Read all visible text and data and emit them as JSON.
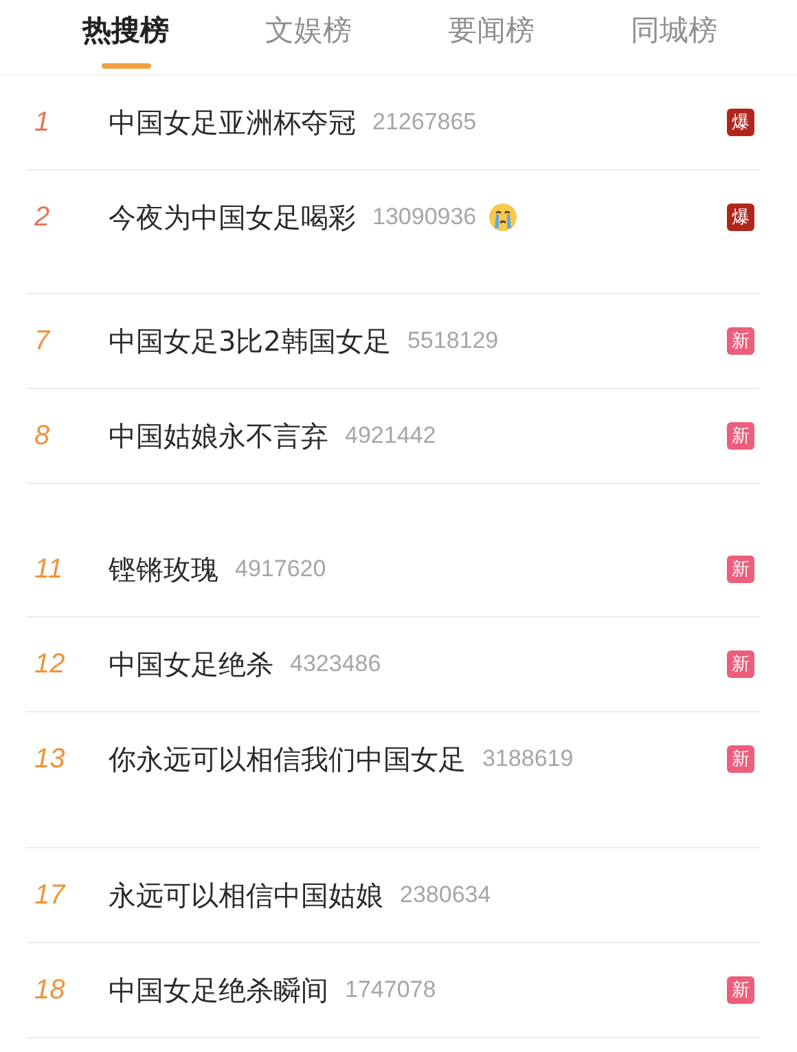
{
  "tabs": [
    {
      "label": "热搜榜",
      "selected": true
    },
    {
      "label": "文娱榜",
      "selected": false
    },
    {
      "label": "要闻榜",
      "selected": false
    },
    {
      "label": "同城榜",
      "selected": false
    }
  ],
  "groups": [
    {
      "rows": [
        {
          "rank": "1",
          "color": "#e5735d",
          "title": "中国女足亚洲杯夺冠",
          "count": "21267865",
          "emoji": false,
          "badge": {
            "kind": "hot",
            "text": "爆"
          }
        },
        {
          "rank": "2",
          "color": "#e5735d",
          "title": "今夜为中国女足喝彩",
          "count": "13090936",
          "emoji": true,
          "badge": {
            "kind": "hot",
            "text": "爆"
          }
        }
      ]
    },
    {
      "rows": [
        {
          "rank": "7",
          "color": "#ef9337",
          "title": "中国女足3比2韩国女足",
          "count": "5518129",
          "emoji": false,
          "badge": {
            "kind": "new",
            "text": "新"
          }
        },
        {
          "rank": "8",
          "color": "#ef9337",
          "title": "中国姑娘永不言弃",
          "count": "4921442",
          "emoji": false,
          "badge": {
            "kind": "new",
            "text": "新"
          }
        }
      ]
    },
    {
      "rows": [
        {
          "rank": "11",
          "color": "#ef9337",
          "title": "铿锵玫瑰",
          "count": "4917620",
          "emoji": false,
          "badge": {
            "kind": "new",
            "text": "新"
          }
        },
        {
          "rank": "12",
          "color": "#ef9337",
          "title": "中国女足绝杀",
          "count": "4323486",
          "emoji": false,
          "badge": {
            "kind": "new",
            "text": "新"
          }
        },
        {
          "rank": "13",
          "color": "#ef9337",
          "title": "你永远可以相信我们中国女足",
          "count": "3188619",
          "emoji": false,
          "badge": {
            "kind": "new",
            "text": "新"
          }
        }
      ]
    },
    {
      "rows": [
        {
          "rank": "17",
          "color": "#ef9337",
          "title": "永远可以相信中国姑娘",
          "count": "2380634",
          "emoji": false
        },
        {
          "rank": "18",
          "color": "#ef9337",
          "title": "中国女足绝杀瞬间",
          "count": "1747078",
          "emoji": false,
          "badge": {
            "kind": "new",
            "text": "新"
          }
        }
      ]
    }
  ]
}
